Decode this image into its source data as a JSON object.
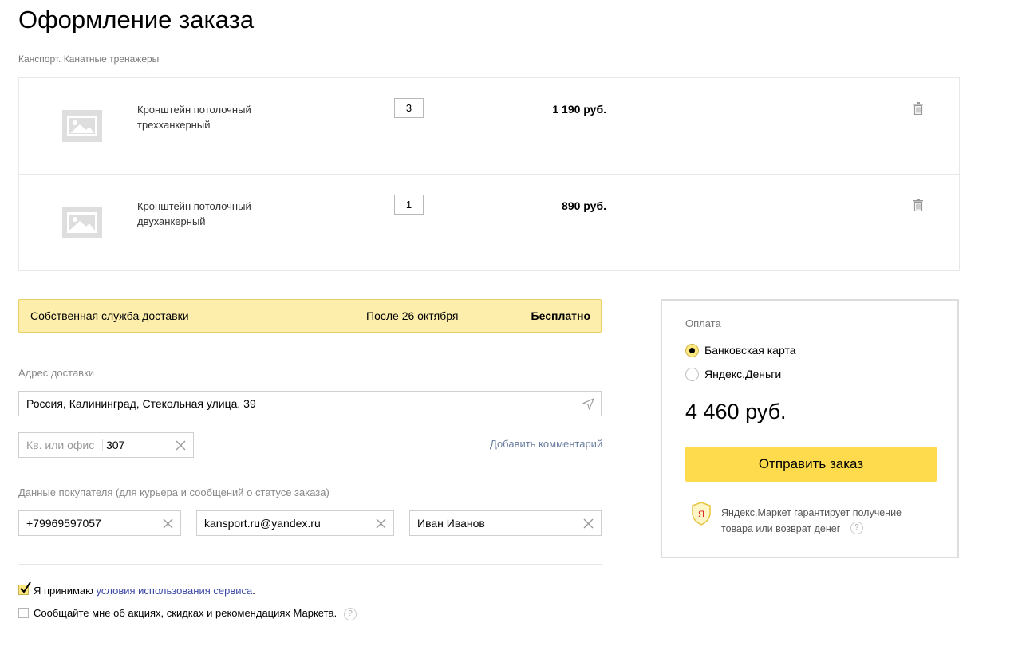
{
  "page": {
    "title": "Оформление заказа",
    "shop": "Канспорт. Канатные тренажеры"
  },
  "items": [
    {
      "name": "Кронштейн потолочный трехханкерный",
      "qty": "3",
      "price": "1 190 руб."
    },
    {
      "name": "Кронштейн потолочный двуханкерный",
      "qty": "1",
      "price": "890 руб."
    }
  ],
  "delivery": {
    "service": "Собственная служба доставки",
    "date": "После 26 октября",
    "price": "Бесплатно"
  },
  "address": {
    "label": "Адрес доставки",
    "value": "Россия, Калининград, Стекольная улица, 39",
    "apt_placeholder": "Кв. или офис",
    "apt_value": "307",
    "add_comment": "Добавить комментарий"
  },
  "buyer": {
    "label": "Данные покупателя (для курьера и сообщений о статусе заказа)",
    "phone": "+79969597057",
    "email": "kansport.ru@yandex.ru",
    "name": "Иван Иванов"
  },
  "consent": {
    "terms_prefix": "Я принимаю ",
    "terms_link": "условия использования сервиса",
    "terms_suffix": ".",
    "terms_checked": true,
    "promo": "Сообщайте мне об акциях, скидках и рекомендациях Маркета.",
    "promo_checked": false,
    "help_mark": "?"
  },
  "payment": {
    "label": "Оплата",
    "options": [
      {
        "label": "Банковская карта",
        "selected": true
      },
      {
        "label": "Яндекс.Деньги",
        "selected": false
      }
    ],
    "total": "4 460 руб.",
    "submit": "Отправить заказ",
    "guarantee": "Яндекс.Маркет гарантирует получение товара или возврат денег",
    "guarantee_badge": "Я",
    "help_mark": "?"
  },
  "colors": {
    "accent_yellow": "#fedb4c",
    "delivery_bg": "#fdeeac",
    "link_blue": "#3b46a6"
  }
}
